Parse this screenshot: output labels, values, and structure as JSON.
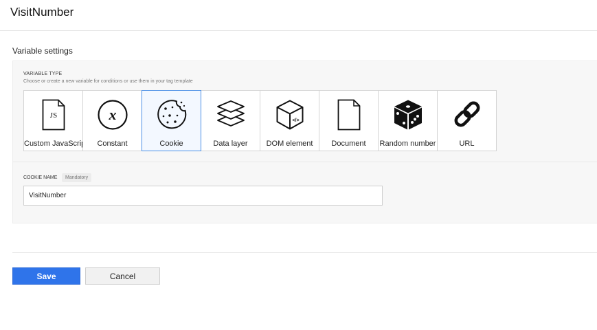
{
  "page": {
    "title": "VisitNumber"
  },
  "settings": {
    "section_label": "Variable settings",
    "variable_type_label": "VARIABLE TYPE",
    "variable_type_hint": "Choose or create a new variable for conditions or use them in your tag template",
    "tiles": [
      {
        "label": "Custom JavaScript",
        "icon": "js-file-icon",
        "selected": false
      },
      {
        "label": "Constant",
        "icon": "constant-x-icon",
        "selected": false
      },
      {
        "label": "Cookie",
        "icon": "cookie-icon",
        "selected": true
      },
      {
        "label": "Data layer",
        "icon": "layers-icon",
        "selected": false
      },
      {
        "label": "DOM element",
        "icon": "cube-code-icon",
        "selected": false
      },
      {
        "label": "Document",
        "icon": "document-icon",
        "selected": false
      },
      {
        "label": "Random number",
        "icon": "dice-icon",
        "selected": false
      },
      {
        "label": "URL",
        "icon": "link-icon",
        "selected": false
      }
    ],
    "cookie_name_label": "COOKIE NAME",
    "mandatory_badge": "Mandatory",
    "cookie_name_value": "VisitNumber"
  },
  "actions": {
    "save_label": "Save",
    "cancel_label": "Cancel"
  },
  "colors": {
    "accent": "#2f74ea",
    "selected_border": "#4a8fe5"
  }
}
